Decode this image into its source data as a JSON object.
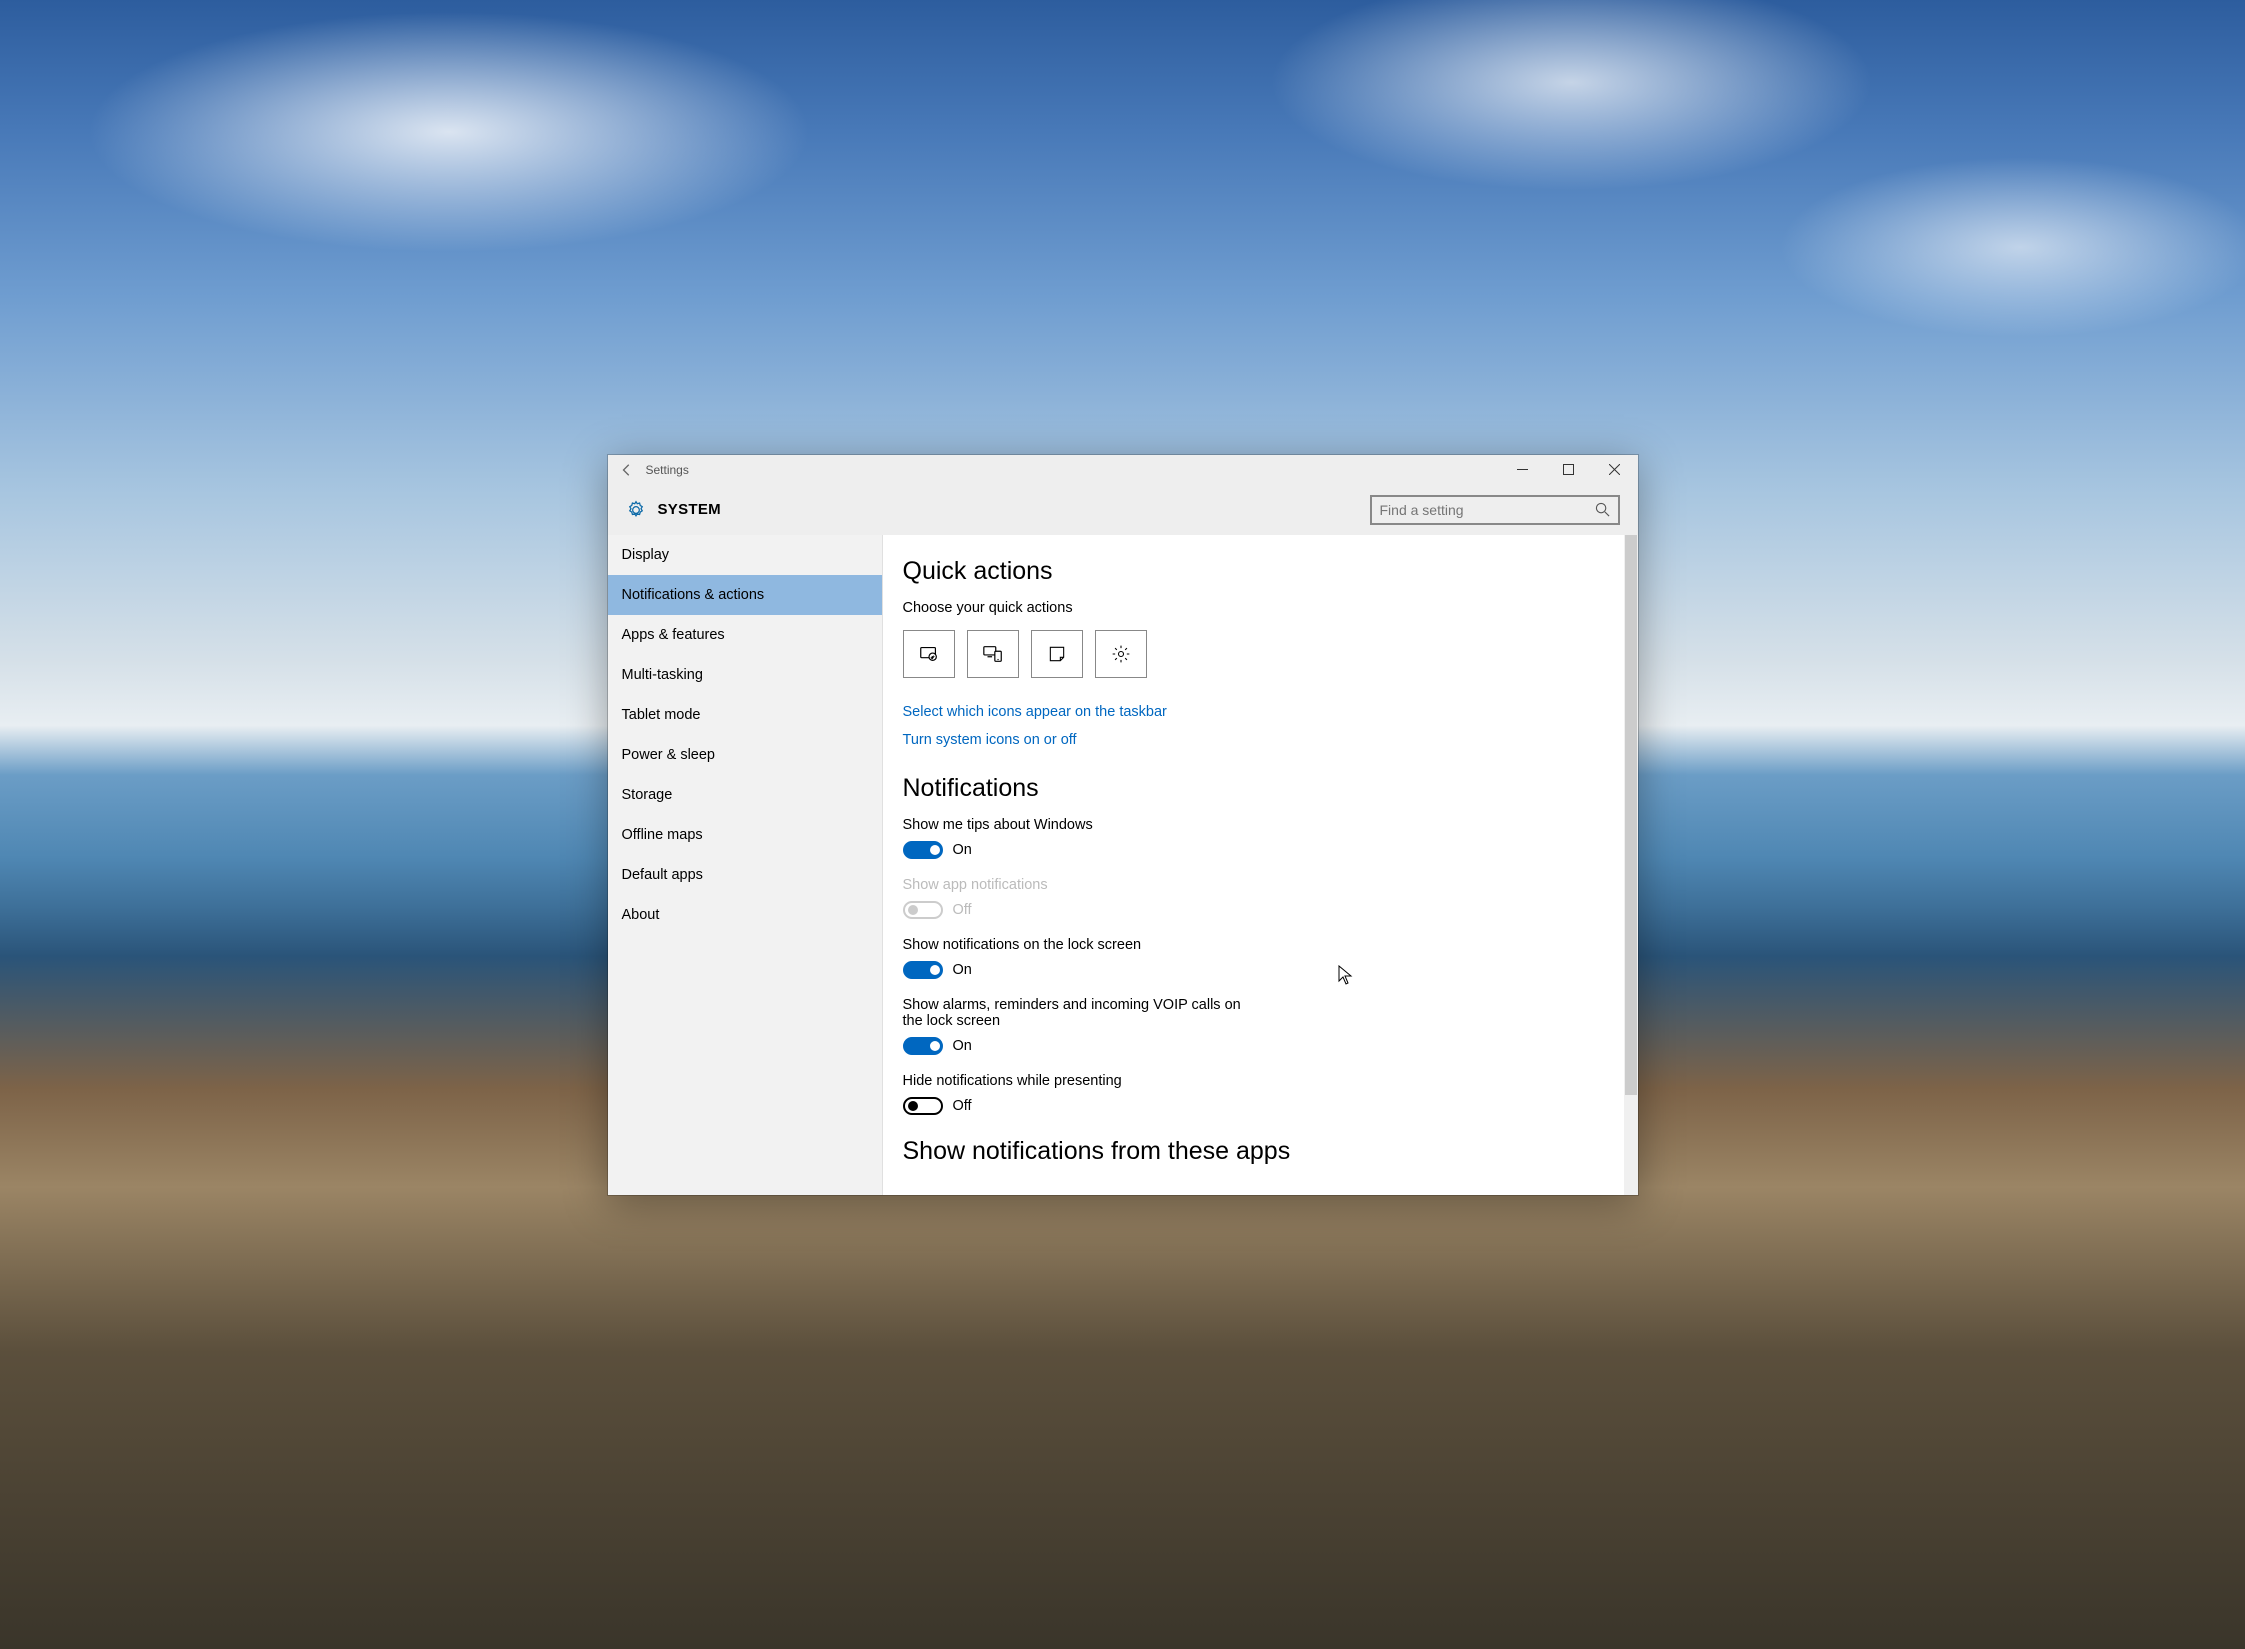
{
  "window": {
    "title": "Settings",
    "category": "SYSTEM"
  },
  "search": {
    "placeholder": "Find a setting"
  },
  "sidebar": {
    "items": [
      {
        "label": "Display",
        "active": false
      },
      {
        "label": "Notifications & actions",
        "active": true
      },
      {
        "label": "Apps & features",
        "active": false
      },
      {
        "label": "Multi-tasking",
        "active": false
      },
      {
        "label": "Tablet mode",
        "active": false
      },
      {
        "label": "Power & sleep",
        "active": false
      },
      {
        "label": "Storage",
        "active": false
      },
      {
        "label": "Offline maps",
        "active": false
      },
      {
        "label": "Default apps",
        "active": false
      },
      {
        "label": "About",
        "active": false
      }
    ]
  },
  "content": {
    "quick_actions": {
      "heading": "Quick actions",
      "subtext": "Choose your quick actions",
      "tiles": [
        "tablet",
        "connect",
        "note",
        "settings"
      ],
      "link1": "Select which icons appear on the taskbar",
      "link2": "Turn system icons on or off"
    },
    "notifications": {
      "heading": "Notifications",
      "toggles": [
        {
          "label": "Show me tips about Windows",
          "on": true,
          "disabled": false,
          "state_on": "On",
          "state_off": "Off"
        },
        {
          "label": "Show app notifications",
          "on": false,
          "disabled": true,
          "state_on": "On",
          "state_off": "Off"
        },
        {
          "label": "Show notifications on the lock screen",
          "on": true,
          "disabled": false,
          "state_on": "On",
          "state_off": "Off"
        },
        {
          "label": "Show alarms, reminders and incoming VOIP calls on the lock screen",
          "on": true,
          "disabled": false,
          "state_on": "On",
          "state_off": "Off"
        },
        {
          "label": "Hide notifications while presenting",
          "on": false,
          "disabled": false,
          "state_on": "On",
          "state_off": "Off"
        }
      ]
    },
    "apps_heading": "Show notifications from these apps"
  },
  "colors": {
    "accent": "#0067c0",
    "sidebar_active": "#8fb8e0"
  }
}
